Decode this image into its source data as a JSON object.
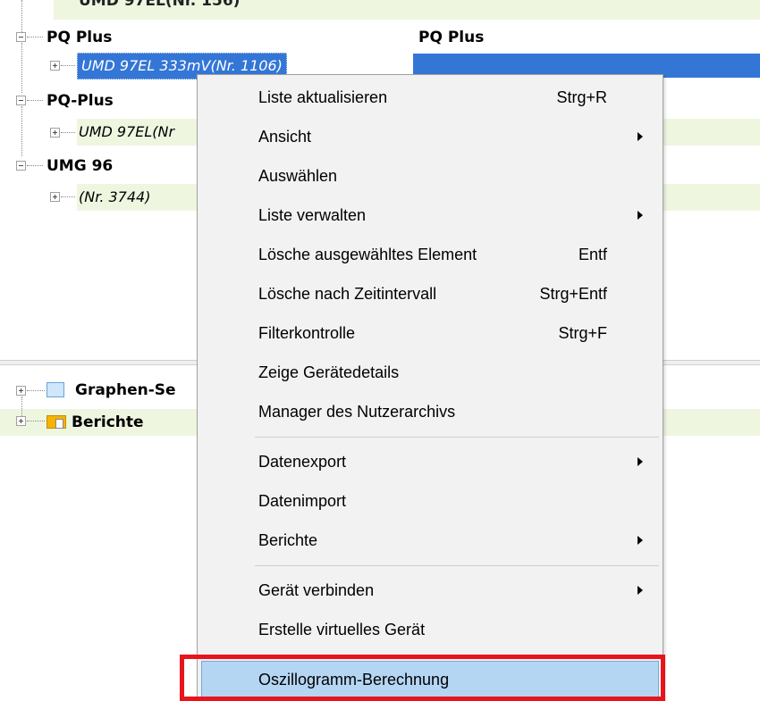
{
  "tree": {
    "partial_top_label": "UMD 97EL(Nr. 156)",
    "groups": [
      {
        "name": "PQ Plus",
        "column_label": "PQ Plus",
        "device": "UMD 97EL 333mV(Nr. 1106)"
      },
      {
        "name": "PQ-Plus",
        "device": "UMD 97EL(Nr"
      },
      {
        "name": "UMG 96",
        "device": "(Nr. 3744)"
      }
    ]
  },
  "lower_tree": {
    "items": [
      {
        "label": "Graphen-Se",
        "icon": "graph-folder-icon"
      },
      {
        "label": "Berichte",
        "icon": "reports-folder-icon"
      }
    ]
  },
  "context_menu": {
    "items": [
      {
        "label": "Liste aktualisieren",
        "shortcut": "Strg+R"
      },
      {
        "label": "Ansicht",
        "submenu": true
      },
      {
        "label": "Auswählen"
      },
      {
        "label": "Liste verwalten",
        "submenu": true
      },
      {
        "label": "Lösche ausgewähltes Element",
        "shortcut": "Entf"
      },
      {
        "label": "Lösche nach Zeitintervall",
        "shortcut": "Strg+Entf"
      },
      {
        "label": "Filterkontrolle",
        "shortcut": "Strg+F"
      },
      {
        "label": "Zeige Gerätedetails"
      },
      {
        "label": "Manager des Nutzerarchivs"
      },
      {
        "label": "Datenexport",
        "submenu": true
      },
      {
        "label": "Datenimport"
      },
      {
        "label": "Berichte",
        "submenu": true
      },
      {
        "label": "Gerät verbinden",
        "submenu": true
      },
      {
        "label": "Erstelle virtuelles Gerät"
      },
      {
        "label": "Oszillogramm-Berechnung",
        "highlighted": true
      }
    ]
  },
  "colors": {
    "selection": "#3476d6",
    "row_highlight": "#eef6e0",
    "menu_active": "#b4d6f3",
    "annotation_red": "#e8141c"
  }
}
